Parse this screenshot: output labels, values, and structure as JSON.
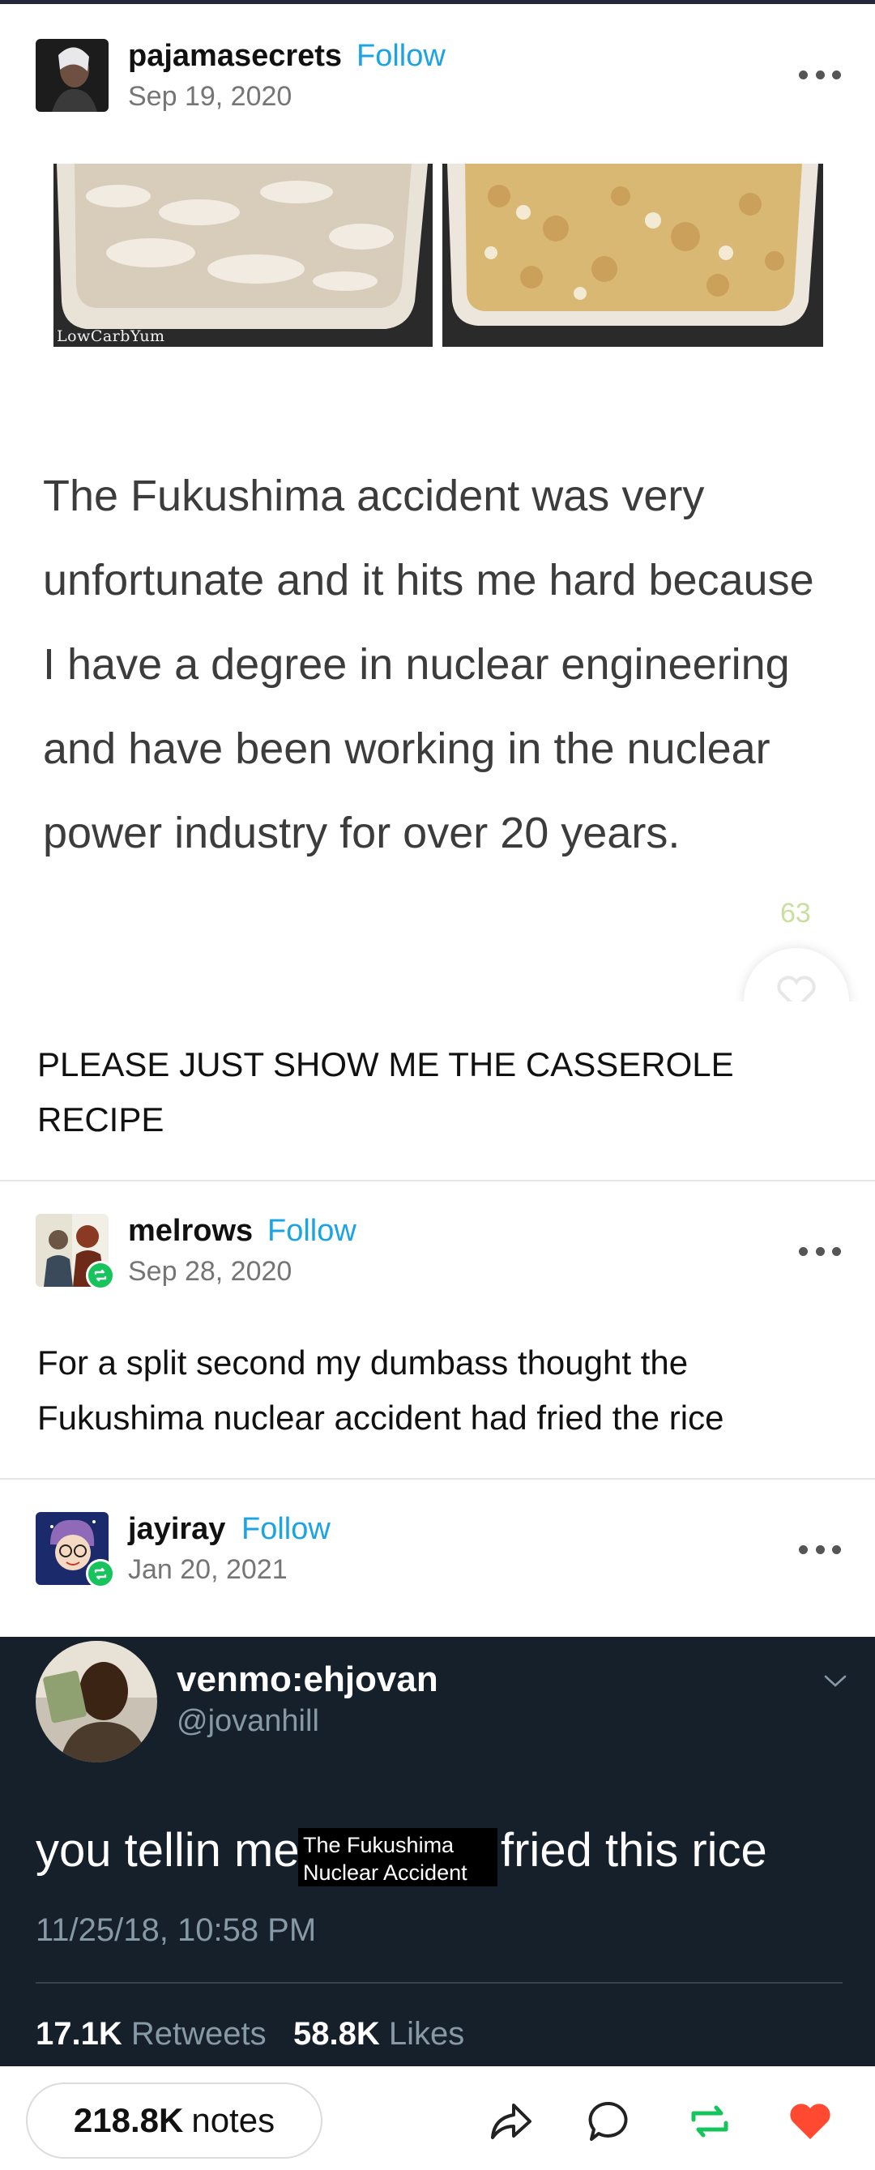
{
  "posts": [
    {
      "username": "pajamasecrets",
      "follow_label": "Follow",
      "date": "Sep 19, 2020"
    },
    {
      "username": "melrows",
      "follow_label": "Follow",
      "date": "Sep 28, 2020",
      "text": "For a split second my dumbass thought the Fukushima nuclear accident had fried the rice"
    },
    {
      "username": "jayiray",
      "follow_label": "Follow",
      "date": "Jan 20, 2021"
    }
  ],
  "photo": {
    "watermark": "LowCarbYum"
  },
  "quote_card": {
    "text": "The Fukushima accident was very unfortunate and it hits me hard because I have a degree in nuclear engineering and have been working in the nuclear power industry for over 20 years.",
    "like_count": "63"
  },
  "reply_text": "PLEASE JUST SHOW ME THE CASSEROLE RECIPE",
  "tweet": {
    "name": "venmo:ehjovan",
    "handle": "@jovanhill",
    "text_before": "you tellin me",
    "sticker_line1": "The Fukushima",
    "sticker_line2": "Nuclear Accident",
    "text_after": "fried this rice",
    "timestamp": "11/25/18, 10:58 PM",
    "retweets_count": "17.1K",
    "retweets_label": "Retweets",
    "likes_count": "58.8K",
    "likes_label": "Likes"
  },
  "footer": {
    "notes_count": "218.8K",
    "notes_label": "notes",
    "icons": [
      "share-icon",
      "reply-icon",
      "reblog-icon",
      "like-icon"
    ]
  },
  "colors": {
    "follow": "#1aa3e8",
    "reblog_green": "#15c45b",
    "like_red": "#ff4930",
    "tweet_bg": "#15202b"
  }
}
